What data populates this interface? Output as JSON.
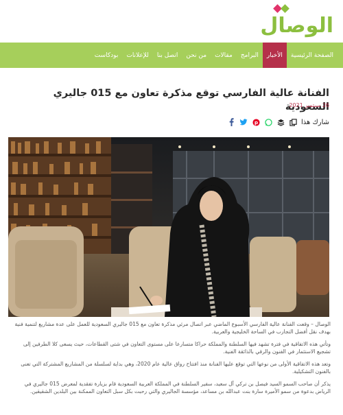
{
  "site": {
    "logo_text": "الوصال"
  },
  "nav": {
    "items": [
      {
        "label": "الصفحة الرئيسية",
        "active": false
      },
      {
        "label": "الأخبار",
        "active": true
      },
      {
        "label": "البرامج",
        "active": false
      },
      {
        "label": "مقالات",
        "active": false
      },
      {
        "label": "من نحن",
        "active": false
      },
      {
        "label": "اتصل بنا",
        "active": false
      },
      {
        "label": "للإعلانات",
        "active": false
      },
      {
        "label": "بودكاست",
        "active": false
      }
    ]
  },
  "article": {
    "title": "الفنانة عالية الفارسي توقع مذكرة تعاون مع 015 جاليري السعودية",
    "date": "26 سبتمبر 2021",
    "share_label": "شارك هذا",
    "paragraphs": [
      "الوصال – وقعت الفنانة عالية الفارسي الأسبوع الماضي عبر اتصال مرئي مذكرة تعاون مع 015 جاليري السعودية للعمل على عدة مشاريع لتنمية فنية بهدف نقل أفضل التجارب في الساحة الخليجية والعربية.",
      "وتأتي هذه الاتفاقية في فترة تشهد فيها السلطنة والمملكة حراكا متسارعا على مستوى التعاون في شتى القطاعات، حيث يسعى كلا الطرفين إلى تشجيع الاستثمار في الفنون والرقي بالذائقة الفنية.",
      "وتعد هذه الاتفاقية الأولى من نوعها التي توقع عليها الفنانة منذ افتتاح رواق عالية عام 2020، وهي بداية لسلسلة من المشاريع المشتركة التي تعنى بالفنون التشكيلية.",
      "يذكر أن صاحب السمو السيد فيصل بن تركي آل سعيد، سفير السلطنة في المملكة العربية السعودية قام بزيارة تفقدية لمعرض 015 جاليري في الرياض بدعوة من سمو الأميرة سارة بنت عبدالله بن مساعد، مؤسسة الجاليري والتي رحبت بكل سبل التعاون الممكنة بين البلدين الشقيقين."
    ]
  },
  "colors": {
    "nav_bg": "#a6cf5b",
    "nav_active": "#b5304a",
    "logo": "#8cbf3f",
    "date": "#b5304a"
  },
  "icons": [
    "copy-icon",
    "layers-icon",
    "whatsapp-icon",
    "pinterest-icon",
    "twitter-icon",
    "facebook-icon"
  ]
}
